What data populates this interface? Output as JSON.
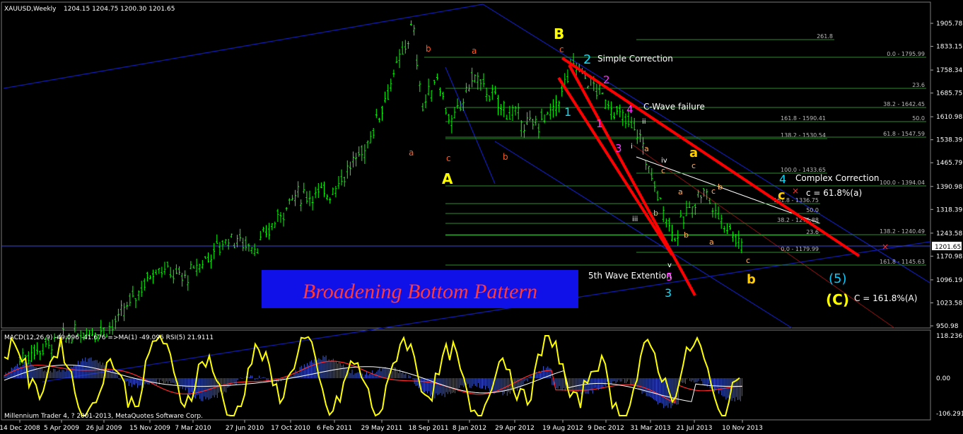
{
  "window": {
    "title": "XAUUSD,Weekly",
    "ohlc": "1204.15 1204.75 1200.30 1201.65",
    "footer": "Millennium Trader 4, ? 2001-2013, MetaQuotes Software Corp."
  },
  "indicator": {
    "label": "MACD(12,26,9) -49.096 -41.676  =>MA(1) -49.096  RSI(5) 21.9111",
    "axis_ticks": [
      "118.236",
      "0.00",
      "-106.291"
    ]
  },
  "price_axis": {
    "ticks": [
      "1905.78",
      "1833.15",
      "1758.34",
      "1685.75",
      "1610.98",
      "1538.39",
      "1465.79",
      "1390.98",
      "1318.39",
      "1243.58",
      "1170.98",
      "1096.19",
      "1023.58",
      "950.98"
    ],
    "current": "1201.65"
  },
  "time_axis": {
    "ticks": [
      "14 Dec 2008",
      "5 Apr 2009",
      "26 Jul 2009",
      "15 Nov 2009",
      "7 Mar 2010",
      "27 Jun 2010",
      "17 Oct 2010",
      "6 Feb 2011",
      "29 May 2011",
      "18 Sep 2011",
      "8 Jan 2012",
      "29 Apr 2012",
      "19 Aug 2012",
      "9 Dec 2012",
      "31 Mar 2013",
      "21 Jul 2013",
      "10 Nov 2013"
    ]
  },
  "banner": {
    "text": "Broadening Bottom Pattern"
  },
  "fib_labels": [
    "261.8",
    "0.0 - 1795.99",
    "23.6",
    "38.2 - 1642.45",
    "161.8 - 1590.41",
    "50.0",
    "138.2 - 1530.54",
    "61.8 - 1547.59",
    "100.0 - 1433.65",
    "100.0 - 1394.04",
    "161.8 - 1336.75",
    "50.0",
    "38.2 - 1276.88",
    "23.6",
    "138.2 - 1240.49",
    "0.0 - 1179.99",
    "161.8 - 1145.63"
  ],
  "annotations": {
    "simple_correction": "Simple Correction",
    "c_wave_failure": "C-Wave failure",
    "complex_correction": "Complex Correction",
    "c_618": "c = 61.8%(a)",
    "fifth_wave": "5th Wave Extention",
    "c_1618": "C = 161.8%(A)"
  },
  "wave_labels": {
    "A": "A",
    "B": "B",
    "C": "(C)",
    "five_paren": "(5)",
    "a_small": "a",
    "b_small": "b",
    "c_small": "c",
    "n1": "1",
    "n2": "2",
    "n3": "3",
    "n4": "4",
    "n5": "5",
    "i": "i",
    "ii": "ii",
    "iii": "iii",
    "iv": "iv",
    "v": "v",
    "x_mark": "×"
  },
  "colors": {
    "background": "#000000",
    "candles": "#00ff00",
    "macd_hist": "#3d5bd6",
    "rsi": "#ffff00",
    "signal": "#ff2a2a",
    "channel": "#0e1aa8",
    "trendline": "#ff0000",
    "fib": "#2d8a2d",
    "banner_bg": "#1010e8",
    "banner_text": "#ff3a3a"
  },
  "chart_data": {
    "type": "candlestick",
    "symbol": "XAUUSD",
    "timeframe": "Weekly",
    "ylim": [
      950.98,
      1905.78
    ],
    "last_close": 1201.65,
    "approx_closes": [
      [
        2008.95,
        850
      ],
      [
        2009.3,
        920
      ],
      [
        2009.6,
        950
      ],
      [
        2009.9,
        1140
      ],
      [
        2010.1,
        1100
      ],
      [
        2010.4,
        1230
      ],
      [
        2010.6,
        1200
      ],
      [
        2010.85,
        1360
      ],
      [
        2011.1,
        1370
      ],
      [
        2011.35,
        1510
      ],
      [
        2011.6,
        1800
      ],
      [
        2011.68,
        1900
      ],
      [
        2011.75,
        1640
      ],
      [
        2011.85,
        1740
      ],
      [
        2011.95,
        1580
      ],
      [
        2012.1,
        1740
      ],
      [
        2012.3,
        1640
      ],
      [
        2012.5,
        1580
      ],
      [
        2012.65,
        1620
      ],
      [
        2012.8,
        1780
      ],
      [
        2012.95,
        1700
      ],
      [
        2013.1,
        1620
      ],
      [
        2013.25,
        1560
      ],
      [
        2013.35,
        1400
      ],
      [
        2013.5,
        1230
      ],
      [
        2013.6,
        1320
      ],
      [
        2013.7,
        1380
      ],
      [
        2013.8,
        1300
      ],
      [
        2013.9,
        1250
      ],
      [
        2013.97,
        1201.65
      ]
    ]
  }
}
